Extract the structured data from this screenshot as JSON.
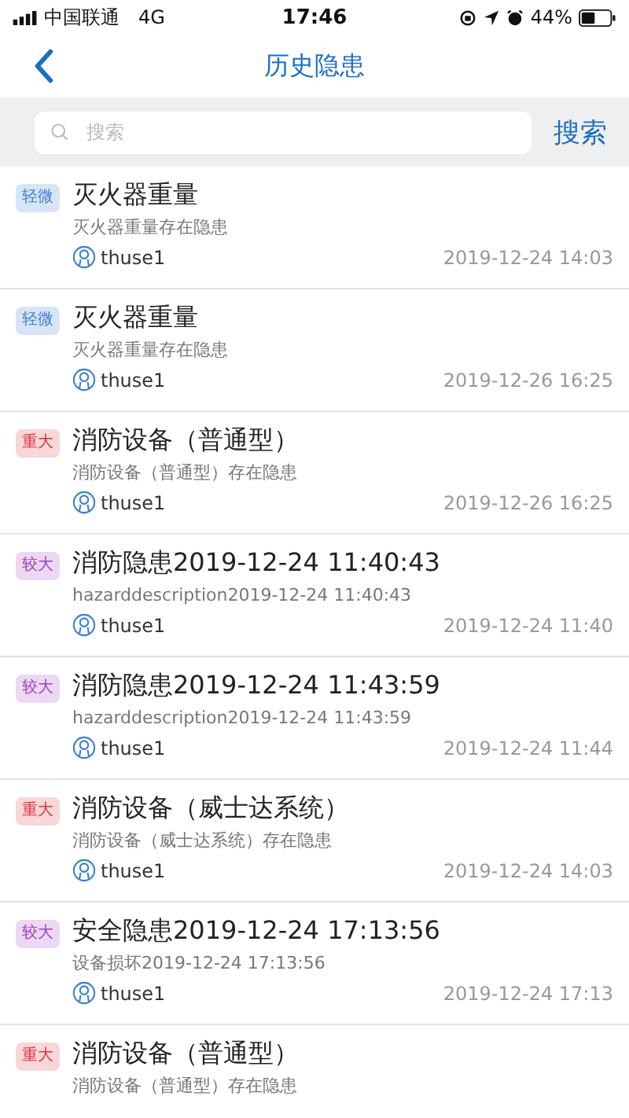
{
  "status_bar": {
    "carrier": "中国联通",
    "network": "4G",
    "time": "17:46",
    "battery": "44%"
  },
  "nav": {
    "title": "历史隐患"
  },
  "search": {
    "placeholder": "搜索",
    "button": "搜索"
  },
  "items": [
    {
      "tag": "轻微",
      "color": "#3b7fd0",
      "title": "灭火器重量",
      "description": "灭火器重量存在隐患",
      "user": "thuse1",
      "time": "2019-12-24 14:03"
    },
    {
      "tag": "轻微",
      "color": "#3b7fd0",
      "title": "灭火器重量",
      "description": "灭火器重量存在隐患",
      "user": "thuse1",
      "time": "2019-12-26 16:25"
    },
    {
      "tag": "重大",
      "color": "#d9363e",
      "title": "消防设备（普通型）",
      "description": "消防设备（普通型）存在隐患",
      "user": "thuse1",
      "time": "2019-12-26 16:25"
    },
    {
      "tag": "较大",
      "color": "#a23ec4",
      "title": "消防隐患2019-12-24 11:40:43",
      "description": "hazarddescription2019-12-24 11:40:43",
      "user": "thuse1",
      "time": "2019-12-24 11:40"
    },
    {
      "tag": "较大",
      "color": "#a23ec4",
      "title": "消防隐患2019-12-24 11:43:59",
      "description": "hazarddescription2019-12-24 11:43:59",
      "user": "thuse1",
      "time": "2019-12-24 11:44"
    },
    {
      "tag": "重大",
      "color": "#d9363e",
      "title": "消防设备（威士达系统）",
      "description": "消防设备（威士达系统）存在隐患",
      "user": "thuse1",
      "time": "2019-12-24 14:03"
    },
    {
      "tag": "较大",
      "color": "#a23ec4",
      "title": "安全隐患2019-12-24 17:13:56",
      "description": "设备损坏2019-12-24 17:13:56",
      "user": "thuse1",
      "time": "2019-12-24 17:13"
    },
    {
      "tag": "重大",
      "color": "#d9363e",
      "title": "消防设备（普通型）",
      "description": "消防设备（普通型）存在隐患"
    }
  ]
}
